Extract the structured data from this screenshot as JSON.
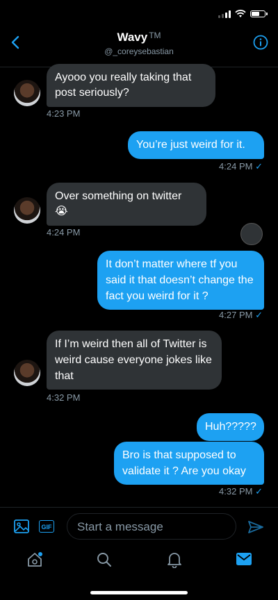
{
  "header": {
    "name": "Wavy",
    "tm": "TM",
    "handle": "@_coreysebastian"
  },
  "messages": [
    {
      "text": "Ayooo you really taking that post seriously?",
      "time": "4:23 PM"
    },
    {
      "text": "You’re just weird for it.",
      "time": "4:24 PM",
      "check": "✓"
    },
    {
      "text": "Over something on twitter",
      "emoji": "😭",
      "time": "4:24 PM"
    },
    {
      "text": "It don’t matter where tf you said it that doesn’t change the fact you weird for it ?",
      "time": "4:27 PM",
      "check": "✓"
    },
    {
      "text": "If I’m weird then all of Twitter is weird cause everyone jokes like that",
      "time": "4:32 PM"
    },
    {
      "text": "Huh?????"
    },
    {
      "text": "Bro is that supposed to validate it ? Are you okay",
      "time": "4:32 PM",
      "check": "✓"
    }
  ],
  "compose": {
    "placeholder": "Start a message",
    "gif_label": "GIF"
  },
  "colors": {
    "accent": "#1da1f2",
    "incoming": "#2f3336",
    "muted": "#8899a6"
  }
}
